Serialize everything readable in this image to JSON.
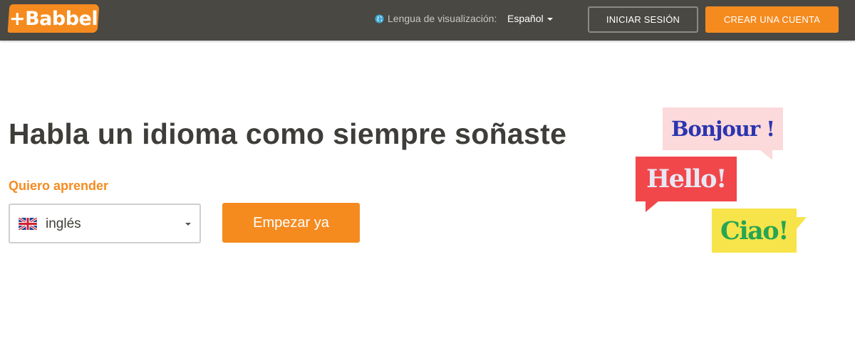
{
  "header": {
    "logo_text": "+Babbel",
    "display_language_label": "Lengua de visualización:",
    "display_language_value": "Español",
    "login_label": "INICIAR SESIÓN",
    "signup_label": "CREAR UNA CUENTA",
    "icons": [
      "globe-icon",
      "chevron-down-icon"
    ]
  },
  "hero": {
    "headline": "Habla un idioma como siempre soñaste",
    "learn_label": "Quiero aprender",
    "language_select": {
      "value": "inglés",
      "icon": "uk-flag-icon"
    },
    "start_button": "Empezar ya"
  },
  "speech_bubbles": [
    {
      "text": "Bonjour !",
      "background": "#fcd9da",
      "color": "#2b35b0"
    },
    {
      "text": "Hello!",
      "background": "#f1474b",
      "color": "#e7e8f4"
    },
    {
      "text": "Ciao!",
      "background": "#f6e44a",
      "color": "#27a553"
    }
  ],
  "colors": {
    "brand_orange": "#f58b1f",
    "header_background": "#4a4843",
    "headline_text": "#3e3d39"
  }
}
